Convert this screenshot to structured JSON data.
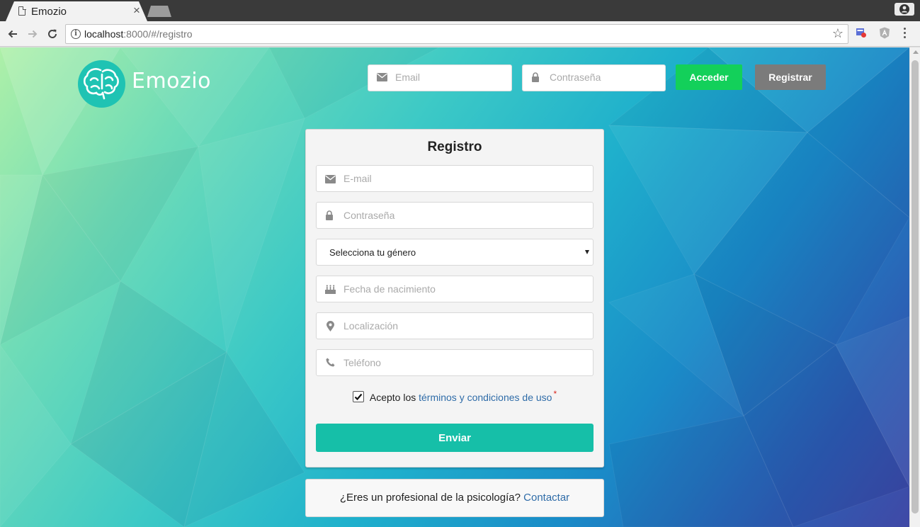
{
  "browser": {
    "tab_title": "Emozio",
    "tab_close": "×",
    "url_host": "localhost",
    "url_rest": ":8000/#/registro"
  },
  "header": {
    "logo_text": "Emozio",
    "email_placeholder": "Email",
    "password_placeholder": "Contraseña",
    "login_label": "Acceder",
    "register_label": "Registrar"
  },
  "form": {
    "title": "Registro",
    "email_placeholder": "E-mail",
    "password_placeholder": "Contraseña",
    "gender_selected": "Selecciona tu género",
    "birthdate_placeholder": "Fecha de nacimiento",
    "location_placeholder": "Localización",
    "phone_placeholder": "Teléfono",
    "terms_prefix": "Acepto los",
    "terms_link": "términos y condiciones de uso",
    "terms_required": "*",
    "terms_checked": true,
    "submit_label": "Enviar"
  },
  "professional": {
    "question": "¿Eres un profesional de la psicología?",
    "contact_link": "Contactar"
  },
  "colors": {
    "accent_teal": "#16bfa8",
    "login_green": "#13d05a",
    "register_gray": "#7b7b7b",
    "link_blue": "#2f6ca8"
  }
}
